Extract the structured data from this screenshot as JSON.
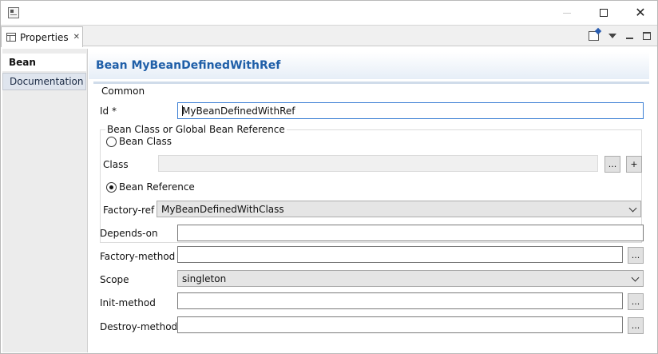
{
  "window": {
    "icon": "app-window-icon",
    "controls": {
      "minimize": "minimize-icon",
      "maximize": "maximize-icon",
      "close": "✕"
    }
  },
  "view": {
    "tab_label": "Properties",
    "tab_close": "✕",
    "toolbar_icons": [
      "pin-editor-icon",
      "view-menu-icon",
      "minimize-icon",
      "maximize-icon"
    ]
  },
  "sidebar": {
    "tabs": [
      {
        "label": "Bean",
        "active": true
      },
      {
        "label": "Documentation",
        "active": false
      }
    ]
  },
  "header": {
    "title": "Bean MyBeanDefinedWithRef"
  },
  "form": {
    "section_title": "Common",
    "id": {
      "label": "Id *",
      "value": "MyBeanDefinedWithRef"
    },
    "bean_group": {
      "title": "Bean Class or Global Bean Reference",
      "bean_class_option": {
        "label": "Bean Class",
        "selected": false
      },
      "class": {
        "label": "Class",
        "value": "",
        "browse_label": "...",
        "add_label": "+"
      },
      "bean_reference_option": {
        "label": "Bean Reference",
        "selected": true
      },
      "factory_ref": {
        "label": "Factory-ref",
        "value": "MyBeanDefinedWithClass"
      }
    },
    "depends_on": {
      "label": "Depends-on",
      "value": ""
    },
    "factory_method": {
      "label": "Factory-method",
      "value": "",
      "browse_label": "..."
    },
    "scope": {
      "label": "Scope",
      "value": "singleton"
    },
    "init_method": {
      "label": "Init-method",
      "value": "",
      "browse_label": "..."
    },
    "destroy_method": {
      "label": "Destroy-method",
      "value": "",
      "browse_label": "..."
    }
  },
  "colors": {
    "header_title": "#1f5fa8",
    "focus_border": "#3c7fd4",
    "sidebar_bg": "#ececec"
  }
}
